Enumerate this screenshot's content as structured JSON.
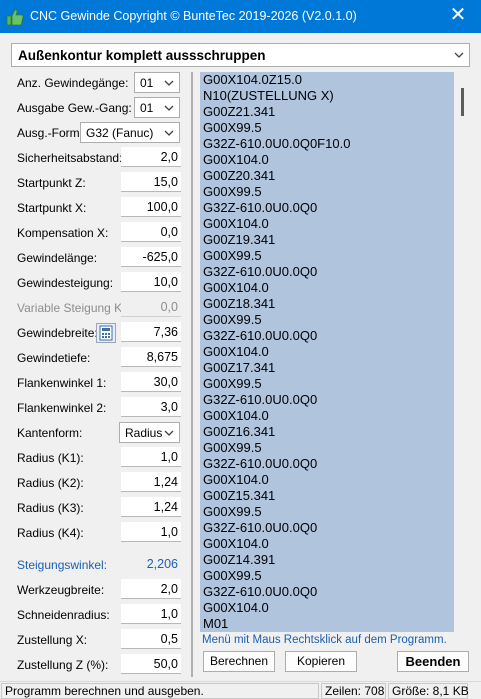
{
  "window": {
    "title": "CNC Gewinde Copyright © BunteTec 2019-2026 (V2.0.1.0)",
    "close_symbol": "✕"
  },
  "mode_select": {
    "value": "Außenkontur komplett aussschruppen"
  },
  "params": {
    "thread_count": {
      "label": "Anz. Gewindegänge:",
      "value": "01"
    },
    "output_count": {
      "label": "Ausgabe Gew.-Gang:",
      "value": "01"
    },
    "output_form": {
      "label": "Ausg.-Form.:",
      "value": "G32 (Fanuc)"
    },
    "safety_distance": {
      "label": "Sicherheitsabstand:",
      "value": "2,0"
    },
    "start_z": {
      "label": "Startpunkt Z:",
      "value": "15,0"
    },
    "start_x": {
      "label": "Startpunkt X:",
      "value": "100,0"
    },
    "compensation_x": {
      "label": "Kompensation X:",
      "value": "0,0"
    },
    "thread_length": {
      "label": "Gewindelänge:",
      "value": "-625,0"
    },
    "thread_pitch": {
      "label": "Gewindesteigung:",
      "value": "10,0"
    },
    "variable_pitch": {
      "label": "Variable Steigung K:",
      "value": "0,0"
    },
    "thread_width": {
      "label": "Gewindebreite:",
      "value": "7,36"
    },
    "thread_depth": {
      "label": "Gewindetiefe:",
      "value": "8,675"
    },
    "flank_angle_1": {
      "label": "Flankenwinkel 1:",
      "value": "30,0"
    },
    "flank_angle_2": {
      "label": "Flankenwinkel 2:",
      "value": "3,0"
    },
    "edge_form": {
      "label": "Kantenform:",
      "value": "Radius"
    },
    "radius_k1": {
      "label": "Radius (K1):",
      "value": "1,0"
    },
    "radius_k2": {
      "label": "Radius (K2):",
      "value": "1,24"
    },
    "radius_k3": {
      "label": "Radius (K3):",
      "value": "1,24"
    },
    "radius_k4": {
      "label": "Radius (K4):",
      "value": "1,0"
    },
    "helix_angle": {
      "label": "Steigungswinkel:",
      "value": "2,206"
    },
    "tool_width": {
      "label": "Werkzeugbreite:",
      "value": "2,0"
    },
    "cutting_radius": {
      "label": "Schneidenradius:",
      "value": "1,0"
    },
    "infeed_x": {
      "label": "Zustellung X:",
      "value": "0,5"
    },
    "infeed_z": {
      "label": "Zustellung Z (%):",
      "value": "50,0"
    }
  },
  "program_lines": [
    "G00X104.0Z15.0",
    "N10(ZUSTELLUNG X)",
    "G00Z21.341",
    "G00X99.5",
    "G32Z-610.0U0.0Q0F10.0",
    "G00X104.0",
    "G00Z20.341",
    "G00X99.5",
    "G32Z-610.0U0.0Q0",
    "G00X104.0",
    "G00Z19.341",
    "G00X99.5",
    "G32Z-610.0U0.0Q0",
    "G00X104.0",
    "G00Z18.341",
    "G00X99.5",
    "G32Z-610.0U0.0Q0",
    "G00X104.0",
    "G00Z17.341",
    "G00X99.5",
    "G32Z-610.0U0.0Q0",
    "G00X104.0",
    "G00Z16.341",
    "G00X99.5",
    "G32Z-610.0U0.0Q0",
    "G00X104.0",
    "G00Z15.341",
    "G00X99.5",
    "G32Z-610.0U0.0Q0",
    "G00X104.0",
    "G00Z14.391",
    "G00X99.5",
    "G32Z-610.0U0.0Q0",
    "G00X104.0",
    "M01"
  ],
  "hint": "Menü mit Maus Rechtsklick auf dem Programm.",
  "buttons": {
    "calculate": "Berechnen",
    "copy": "Kopieren",
    "quit": "Beenden"
  },
  "statusbar": {
    "message": "Programm berechnen und ausgeben.",
    "lines": "Zeilen: 708",
    "size": "Größe: 8,1 KB"
  },
  "colors": {
    "titlebar": "#0078d7",
    "code_bg": "#b0c4de",
    "accent_text": "#1a5fb4"
  }
}
